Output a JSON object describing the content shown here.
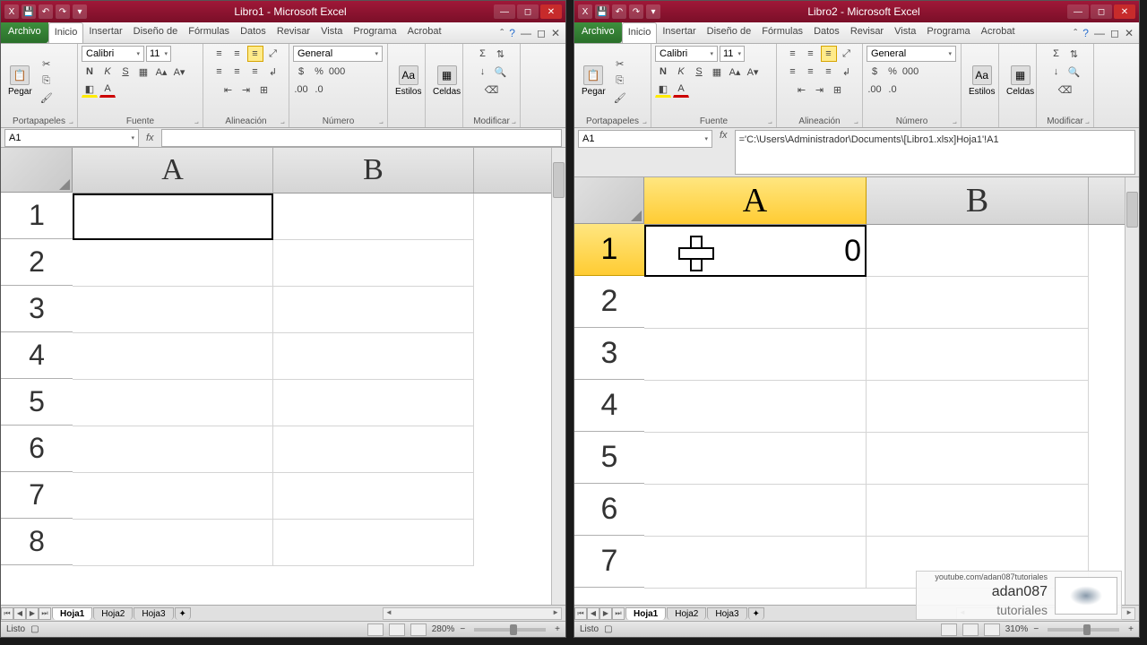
{
  "left": {
    "title": "Libro1 - Microsoft Excel",
    "tabs": {
      "archivo": "Archivo",
      "inicio": "Inicio",
      "insertar": "Insertar",
      "diseno": "Diseño de",
      "formulas": "Fórmulas",
      "datos": "Datos",
      "revisar": "Revisar",
      "vista": "Vista",
      "programa": "Programa",
      "acrobat": "Acrobat"
    },
    "ribbon": {
      "paste": "Pegar",
      "clipboard": "Portapapeles",
      "font_name": "Calibri",
      "font_size": "11",
      "font": "Fuente",
      "align": "Alineación",
      "num_format": "General",
      "number": "Número",
      "styles": "Estilos",
      "cells": "Celdas",
      "editing": "Modificar"
    },
    "namebox": "A1",
    "formula": "",
    "cols": [
      "A",
      "B"
    ],
    "rows": [
      "1",
      "2",
      "3",
      "4",
      "5",
      "6",
      "7",
      "8"
    ],
    "sheets": {
      "h1": "Hoja1",
      "h2": "Hoja2",
      "h3": "Hoja3"
    },
    "status": "Listo",
    "zoom": "280%"
  },
  "right": {
    "title": "Libro2 - Microsoft Excel",
    "tabs": {
      "archivo": "Archivo",
      "inicio": "Inicio",
      "insertar": "Insertar",
      "diseno": "Diseño de",
      "formulas": "Fórmulas",
      "datos": "Datos",
      "revisar": "Revisar",
      "vista": "Vista",
      "programa": "Programa",
      "acrobat": "Acrobat"
    },
    "ribbon": {
      "paste": "Pegar",
      "clipboard": "Portapapeles",
      "font_name": "Calibri",
      "font_size": "11",
      "font": "Fuente",
      "align": "Alineación",
      "num_format": "General",
      "number": "Número",
      "styles": "Estilos",
      "cells": "Celdas",
      "editing": "Modificar"
    },
    "namebox": "A1",
    "formula": "='C:\\Users\\Administrador\\Documents\\[Libro1.xlsx]Hoja1'!A1",
    "cols": [
      "A",
      "B"
    ],
    "rows": [
      "1",
      "2",
      "3",
      "4",
      "5",
      "6",
      "7"
    ],
    "cellA1": "0",
    "sheets": {
      "h1": "Hoja1",
      "h2": "Hoja2",
      "h3": "Hoja3"
    },
    "status": "Listo",
    "zoom": "310%"
  },
  "watermark": {
    "line1": "youtube.com/adan087tutoriales",
    "line2": "adan087",
    "line3": "tutoriales"
  }
}
